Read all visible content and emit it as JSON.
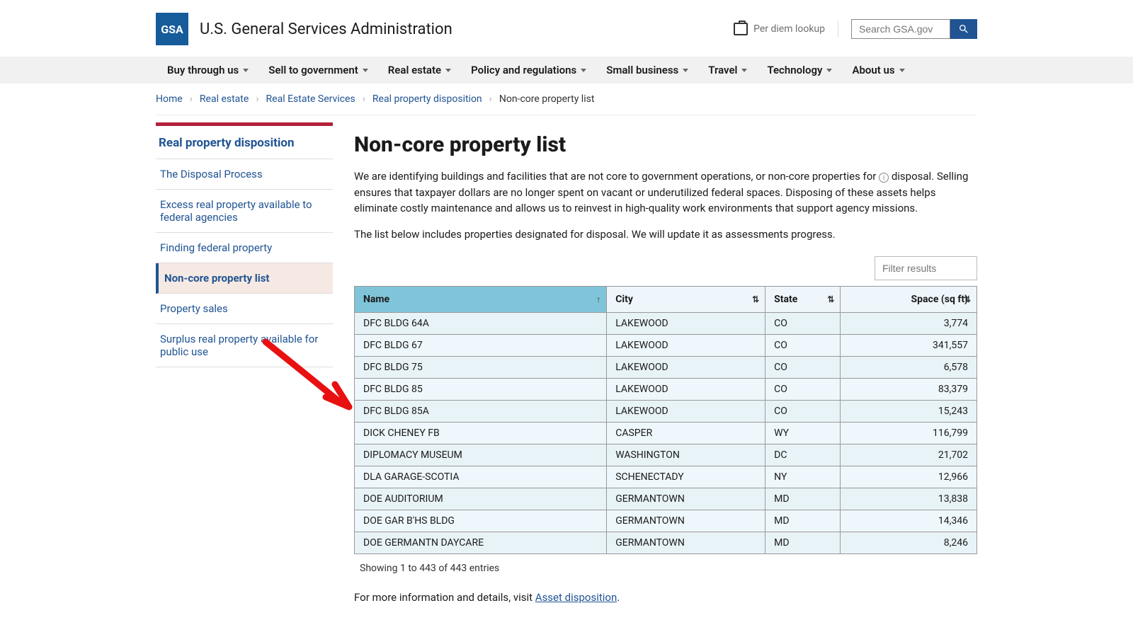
{
  "header": {
    "logo_text": "GSA",
    "site_title": "U.S. General Services Administration",
    "perdiem_label": "Per diem lookup",
    "search_placeholder": "Search GSA.gov"
  },
  "nav": [
    "Buy through us",
    "Sell to government",
    "Real estate",
    "Policy and regulations",
    "Small business",
    "Travel",
    "Technology",
    "About us"
  ],
  "breadcrumbs": [
    {
      "label": "Home",
      "current": false
    },
    {
      "label": "Real estate",
      "current": false
    },
    {
      "label": "Real Estate Services",
      "current": false
    },
    {
      "label": "Real property disposition",
      "current": false
    },
    {
      "label": "Non-core property list",
      "current": true
    }
  ],
  "sidebar": {
    "title": "Real property disposition",
    "items": [
      {
        "label": "The Disposal Process",
        "active": false
      },
      {
        "label": "Excess real property available to federal agencies",
        "active": false
      },
      {
        "label": "Finding federal property",
        "active": false
      },
      {
        "label": "Non-core property list",
        "active": true
      },
      {
        "label": "Property sales",
        "active": false
      },
      {
        "label": "Surplus real property available for public use",
        "active": false
      }
    ]
  },
  "page": {
    "title": "Non-core property list",
    "intro1a": "We are identifying buildings and facilities that are not core to government operations, or non-core properties for ",
    "intro1b": " disposal. Selling ensures that taxpayer dollars are no longer spent on vacant or underutilized federal spaces. Disposing of these assets helps eliminate costly maintenance and allows us to reinvest in high-quality work environments that support agency missions.",
    "intro2": "The list below includes properties designated for disposal. We will update it as assessments progress.",
    "filter_placeholder": "Filter results",
    "showing": "Showing 1 to 443 of 443 entries",
    "footer_text_a": "For more information and details, visit ",
    "footer_link": "Asset disposition",
    "footer_text_b": "."
  },
  "table": {
    "columns": [
      {
        "label": "Name",
        "sorted": true,
        "align": "left"
      },
      {
        "label": "City",
        "sorted": false,
        "align": "left"
      },
      {
        "label": "State",
        "sorted": false,
        "align": "left"
      },
      {
        "label": "Space (sq ft)",
        "sorted": false,
        "align": "right"
      }
    ],
    "rows": [
      {
        "name": "DFC BLDG 64A",
        "city": "LAKEWOOD",
        "state": "CO",
        "space": "3,774"
      },
      {
        "name": "DFC BLDG 67",
        "city": "LAKEWOOD",
        "state": "CO",
        "space": "341,557"
      },
      {
        "name": "DFC BLDG 75",
        "city": "LAKEWOOD",
        "state": "CO",
        "space": "6,578"
      },
      {
        "name": "DFC BLDG 85",
        "city": "LAKEWOOD",
        "state": "CO",
        "space": "83,379"
      },
      {
        "name": "DFC BLDG 85A",
        "city": "LAKEWOOD",
        "state": "CO",
        "space": "15,243"
      },
      {
        "name": "DICK CHENEY FB",
        "city": "CASPER",
        "state": "WY",
        "space": "116,799"
      },
      {
        "name": "DIPLOMACY MUSEUM",
        "city": "WASHINGTON",
        "state": "DC",
        "space": "21,702"
      },
      {
        "name": "DLA GARAGE-SCOTIA",
        "city": "SCHENECTADY",
        "state": "NY",
        "space": "12,966"
      },
      {
        "name": "DOE AUDITORIUM",
        "city": "GERMANTOWN",
        "state": "MD",
        "space": "13,838"
      },
      {
        "name": "DOE GAR B'HS BLDG",
        "city": "GERMANTOWN",
        "state": "MD",
        "space": "14,346"
      },
      {
        "name": "DOE GERMANTN DAYCARE",
        "city": "GERMANTOWN",
        "state": "MD",
        "space": "8,246"
      }
    ]
  }
}
